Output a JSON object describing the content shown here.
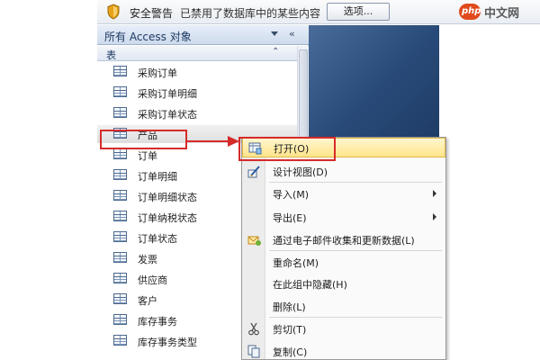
{
  "security_bar": {
    "title": "安全警告",
    "message": "已禁用了数据库中的某些内容",
    "options_button": "选项..."
  },
  "nav_pane": {
    "title": "所有 Access 对象",
    "shutter_glyph": "«",
    "collapse_glyph": "⌃",
    "group_label": "表",
    "items": [
      {
        "label": "采购订单"
      },
      {
        "label": "采购订单明细"
      },
      {
        "label": "采购订单状态"
      },
      {
        "label": "产品"
      },
      {
        "label": "订单"
      },
      {
        "label": "订单明细"
      },
      {
        "label": "订单明细状态"
      },
      {
        "label": "订单纳税状态"
      },
      {
        "label": "订单状态"
      },
      {
        "label": "发票"
      },
      {
        "label": "供应商"
      },
      {
        "label": "客户"
      },
      {
        "label": "库存事务"
      },
      {
        "label": "库存事务类型"
      }
    ],
    "selected_index": 3
  },
  "context_menu": {
    "items": [
      {
        "label": "打开(O)",
        "icon": "open-table-icon",
        "highlighted": true
      },
      {
        "label": "设计视图(D)",
        "icon": "design-view-icon"
      },
      {
        "label": "导入(M)",
        "submenu": true
      },
      {
        "label": "导出(E)",
        "submenu": true
      },
      {
        "label": "通过电子邮件收集和更新数据(L)",
        "icon": "email-collect-icon"
      },
      {
        "label": "重命名(M)"
      },
      {
        "label": "在此组中隐藏(H)"
      },
      {
        "label": "删除(L)"
      },
      {
        "label": "剪切(T)",
        "icon": "scissors-icon"
      },
      {
        "label": "复制(C)",
        "icon": "copy-icon"
      }
    ]
  },
  "watermark": {
    "badge": "php",
    "text": "中文网"
  },
  "colors": {
    "highlight_box": "#d62b2b",
    "menu_highlight": "#ffe58a",
    "workarea": "#284a78"
  }
}
